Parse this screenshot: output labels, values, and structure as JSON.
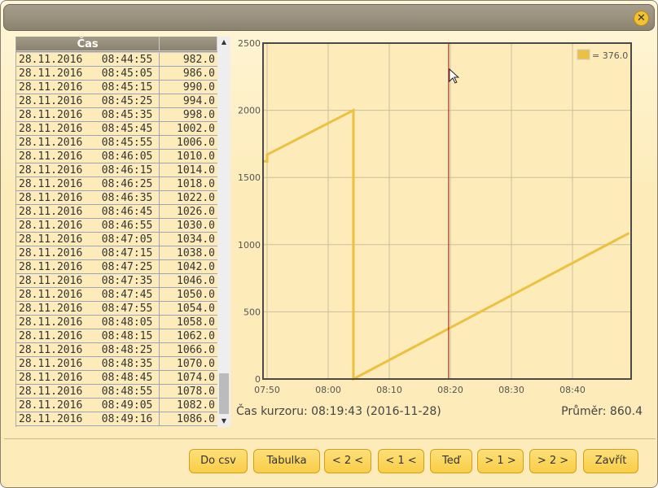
{
  "window": {
    "close_icon": "close-icon"
  },
  "table": {
    "headers": [
      "Čas",
      ""
    ],
    "rows": [
      [
        "28.11.2016   08:44:55",
        "982.0"
      ],
      [
        "28.11.2016   08:45:05",
        "986.0"
      ],
      [
        "28.11.2016   08:45:15",
        "990.0"
      ],
      [
        "28.11.2016   08:45:25",
        "994.0"
      ],
      [
        "28.11.2016   08:45:35",
        "998.0"
      ],
      [
        "28.11.2016   08:45:45",
        "1002.0"
      ],
      [
        "28.11.2016   08:45:55",
        "1006.0"
      ],
      [
        "28.11.2016   08:46:05",
        "1010.0"
      ],
      [
        "28.11.2016   08:46:15",
        "1014.0"
      ],
      [
        "28.11.2016   08:46:25",
        "1018.0"
      ],
      [
        "28.11.2016   08:46:35",
        "1022.0"
      ],
      [
        "28.11.2016   08:46:45",
        "1026.0"
      ],
      [
        "28.11.2016   08:46:55",
        "1030.0"
      ],
      [
        "28.11.2016   08:47:05",
        "1034.0"
      ],
      [
        "28.11.2016   08:47:15",
        "1038.0"
      ],
      [
        "28.11.2016   08:47:25",
        "1042.0"
      ],
      [
        "28.11.2016   08:47:35",
        "1046.0"
      ],
      [
        "28.11.2016   08:47:45",
        "1050.0"
      ],
      [
        "28.11.2016   08:47:55",
        "1054.0"
      ],
      [
        "28.11.2016   08:48:05",
        "1058.0"
      ],
      [
        "28.11.2016   08:48:15",
        "1062.0"
      ],
      [
        "28.11.2016   08:48:25",
        "1066.0"
      ],
      [
        "28.11.2016   08:48:35",
        "1070.0"
      ],
      [
        "28.11.2016   08:48:45",
        "1074.0"
      ],
      [
        "28.11.2016   08:48:55",
        "1078.0"
      ],
      [
        "28.11.2016   08:49:05",
        "1082.0"
      ],
      [
        "28.11.2016   08:49:16",
        "1086.0"
      ]
    ]
  },
  "chart_data": {
    "type": "line",
    "xlim": [
      "07:49:20",
      "08:49:36"
    ],
    "ylim": [
      0,
      2500
    ],
    "xticks": [
      "07:50",
      "08:00",
      "08:10",
      "08:20",
      "08:30",
      "08:40"
    ],
    "yticks": [
      "0",
      "500",
      "1000",
      "1500",
      "2000",
      "2500"
    ],
    "grid": true,
    "legend": "top-right",
    "legend_label": "= 376.0",
    "series_color": "#ecc041",
    "cursor_color": "#a01010",
    "cursor_time": "08:19:43",
    "points": [
      [
        "07:49:20",
        1620
      ],
      [
        "07:50:00",
        1620
      ],
      [
        "07:50:00",
        1670
      ],
      [
        "08:04:08",
        2000
      ],
      [
        "08:04:08",
        0
      ],
      [
        "08:49:16",
        1086
      ]
    ]
  },
  "status": {
    "cursor": "Čas kurzoru: 08:19:43 (2016-11-28)",
    "average": "Průměr: 860.4"
  },
  "buttons": [
    "Do csv",
    "Tabulka",
    "< 2 <",
    "< 1 <",
    "Teď",
    "> 1 >",
    "> 2 >",
    "Zavřít"
  ]
}
